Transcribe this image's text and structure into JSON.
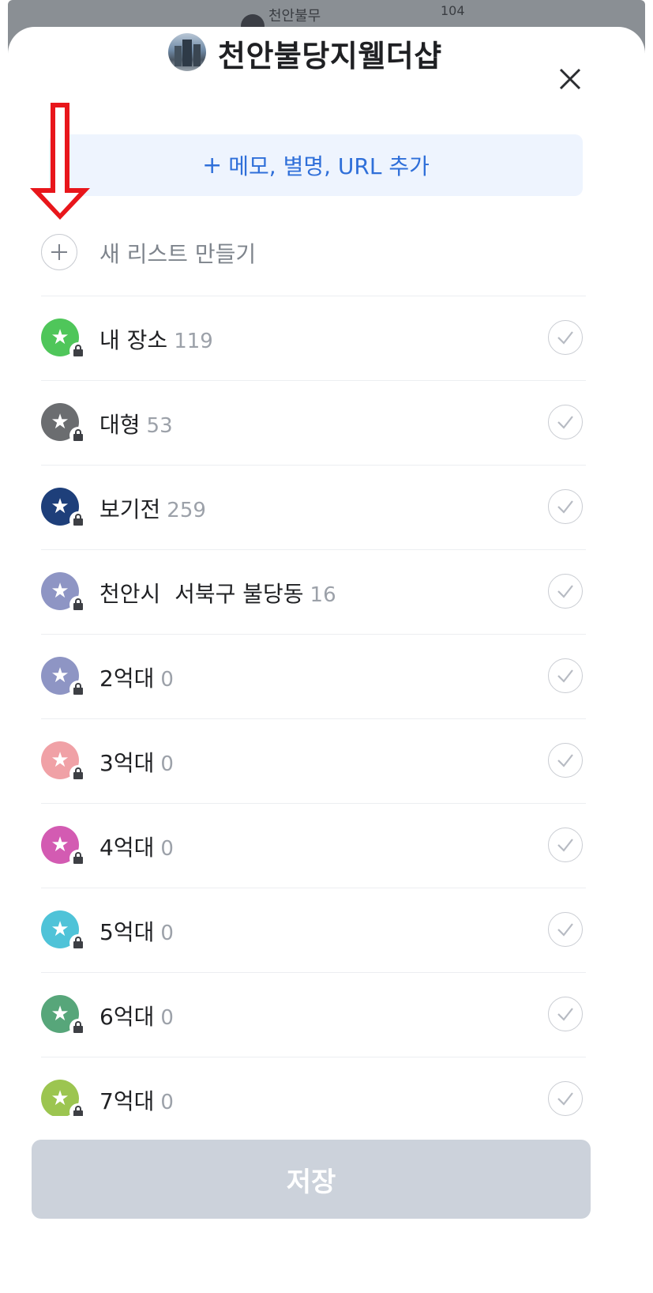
{
  "map": {
    "label": "천안불무",
    "label2": "104"
  },
  "header": {
    "title": "천안불당지웰더샵"
  },
  "memo": {
    "label": "메모, 별명, URL 추가"
  },
  "new_list": {
    "label": "새 리스트 만들기"
  },
  "lists": [
    {
      "name": "내 장소",
      "count": "119",
      "color": "#4fc65a"
    },
    {
      "name": "대형",
      "count": "53",
      "color": "#6b6d70"
    },
    {
      "name": "보기전",
      "count": "259",
      "color": "#1e3f7a"
    },
    {
      "name": "천안시  서북구 불당동",
      "count": "16",
      "color": "#8e95c4"
    },
    {
      "name": "2억대",
      "count": "0",
      "color": "#8e95c4"
    },
    {
      "name": "3억대",
      "count": "0",
      "color": "#f0a1a6"
    },
    {
      "name": "4억대",
      "count": "0",
      "color": "#d35bb2"
    },
    {
      "name": "5억대",
      "count": "0",
      "color": "#4fc3d8"
    },
    {
      "name": "6억대",
      "count": "0",
      "color": "#57a67a"
    },
    {
      "name": "7억대",
      "count": "0",
      "color": "#9cc550"
    }
  ],
  "save": {
    "label": "저장"
  },
  "annotation": {
    "arrow_color": "#e8161b"
  }
}
